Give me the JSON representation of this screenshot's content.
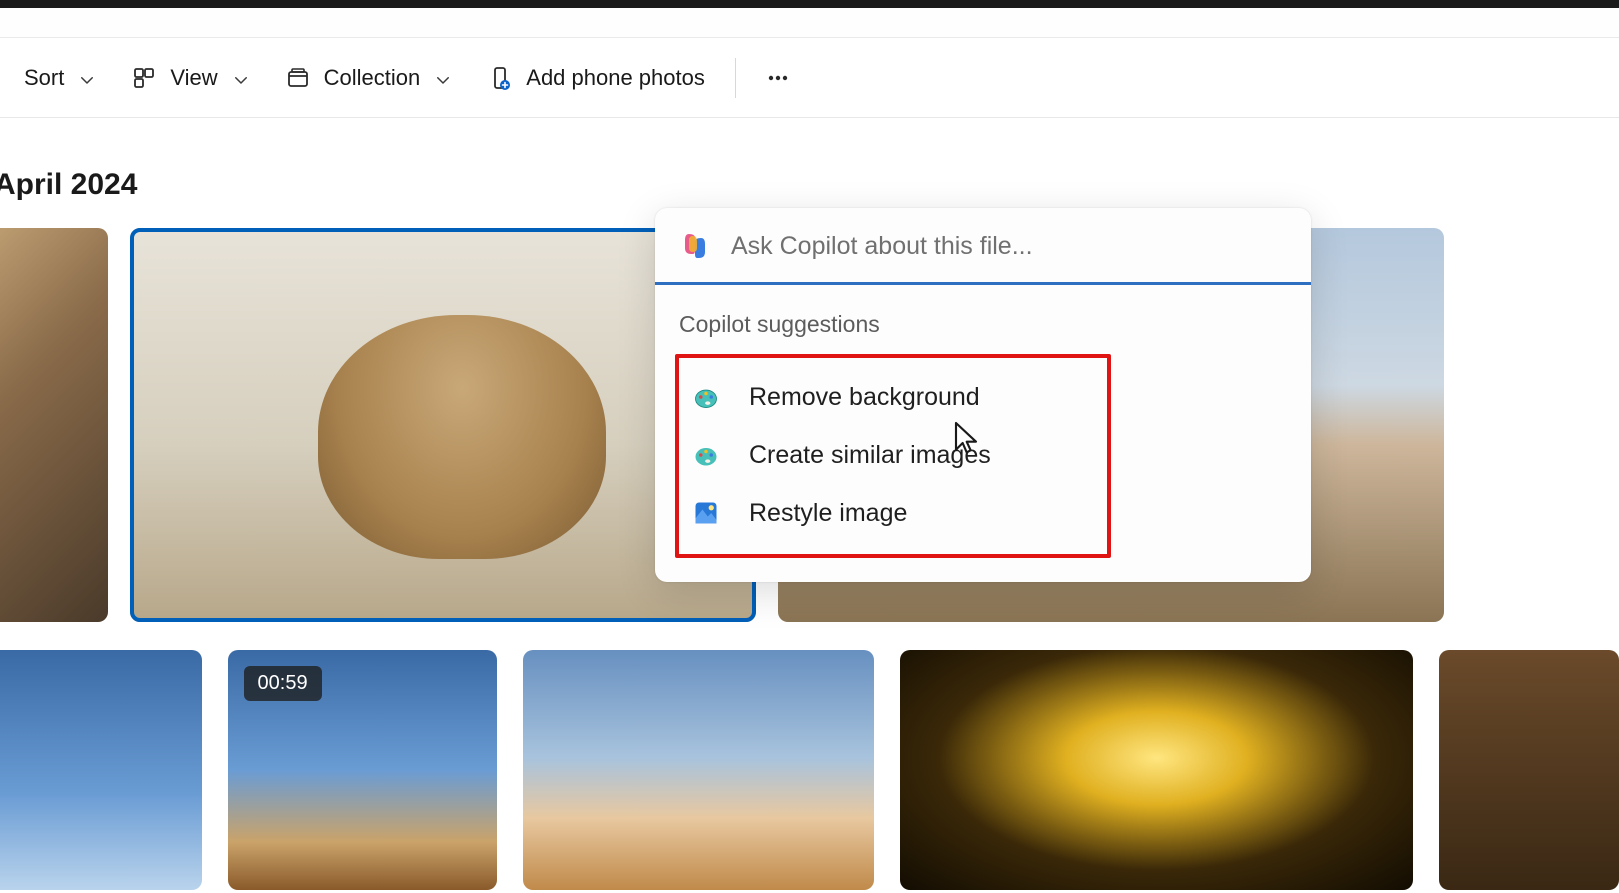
{
  "toolbar": {
    "sort": "Sort",
    "view": "View",
    "collection": "Collection",
    "add_phone": "Add phone photos"
  },
  "date_header": "April 2024",
  "video_duration": "00:59",
  "copilot": {
    "placeholder": "Ask Copilot about this file...",
    "suggestions_title": "Copilot suggestions",
    "items": [
      "Remove background",
      "Create similar images",
      "Restyle image"
    ]
  }
}
